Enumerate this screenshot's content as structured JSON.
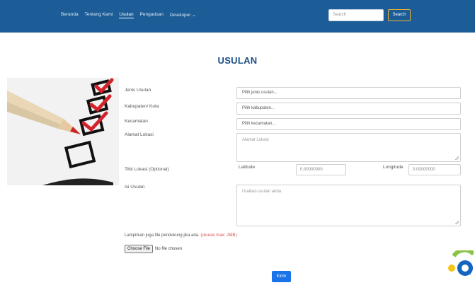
{
  "nav": {
    "links": [
      "Beranda",
      "Tentang Kami",
      "Usulan",
      "Pengaduan",
      "Developer ⌄"
    ],
    "search_placeholder": "Search",
    "search_button": "Search"
  },
  "page": {
    "title": "USULAN"
  },
  "form": {
    "jenis_label": "Jenis Usulan",
    "jenis_value": "Pilih jenis usulan...",
    "kabupaten_label": "Kabupaten/ Kota",
    "kabupaten_value": "Pilih kabupaten...",
    "kecamatan_label": "Kecamatan",
    "kecamatan_value": "Pilih kecamatan...",
    "alamat_label": "Alamat Lokasi",
    "alamat_placeholder": "Alamat Lokasi",
    "titik_label": "Titik Lokasi (Optional)",
    "latitude_label": "Latitude",
    "latitude_value": "0.00000000",
    "longitude_label": "Longitude",
    "longitude_value": "0.00000000",
    "isi_label": "Isi Usulan",
    "isi_placeholder": "Uraikan usulan anda",
    "lampiran_label": "Lampirkan juga file pendukung jika ada.",
    "lampiran_hint": "(ukuran max: 2MB)",
    "choose_file": "Choose File",
    "file_status": "No file chosen",
    "submit": "Kirim"
  },
  "colors": {
    "nav": "#1c5d97",
    "title": "#1c4e84",
    "button": "#1a73e8",
    "hint": "#d9534f",
    "search_border": "#e7b23a"
  },
  "icons": [
    "checklist-illustration",
    "chat-icon"
  ]
}
